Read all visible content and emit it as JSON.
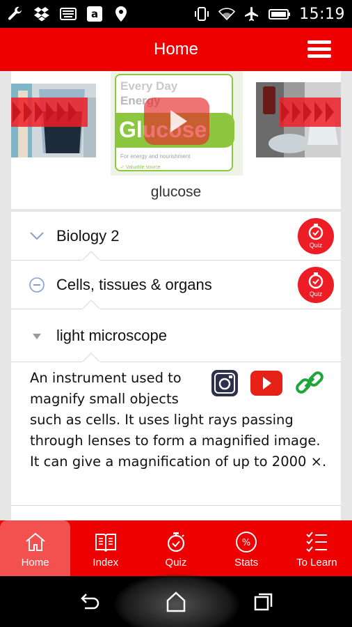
{
  "status_bar": {
    "time": "15:19",
    "left_icons": [
      "wrench-icon",
      "dropbox-icon",
      "keyboard-icon",
      "amazon-icon",
      "location-icon"
    ],
    "right_icons": [
      "vibrate-icon",
      "wifi-icon",
      "airplane-icon",
      "battery-icon"
    ]
  },
  "app_bar": {
    "title": "Home",
    "menu_icon": "hamburger-menu-icon"
  },
  "carousel": {
    "caption": "glucose",
    "center_image": {
      "line1": "Every Day",
      "line2": "Energy",
      "line3": "Glucose",
      "line4": "For energy and nourishment",
      "line5": "✓ Valuable source"
    }
  },
  "accordion": {
    "level1": {
      "label": "Biology 2",
      "quiz_label": "Quiz"
    },
    "level2": {
      "label": "Cells, tissues & organs",
      "quiz_label": "Quiz"
    },
    "term": {
      "label": "light microscope"
    },
    "definition": "An instrument used to magnify small objects such as cells. It uses light rays passing through lenses to form a magnified image. It can give a magnification of up to 2000 ×.",
    "media_icons": [
      "instagram-icon",
      "youtube-icon",
      "link-icon"
    ]
  },
  "bottom_nav": {
    "items": [
      {
        "label": "Home",
        "icon": "home-icon",
        "active": true
      },
      {
        "label": "Index",
        "icon": "book-icon",
        "active": false
      },
      {
        "label": "Quiz",
        "icon": "stopwatch-icon",
        "active": false
      },
      {
        "label": "Stats",
        "icon": "percent-icon",
        "active": false
      },
      {
        "label": "To Learn",
        "icon": "checklist-icon",
        "active": false
      }
    ]
  },
  "system_nav": [
    "back-icon",
    "home-icon",
    "recent-apps-icon"
  ],
  "colors": {
    "brand_red": "#ee0000",
    "active_tab": "#f35050",
    "quiz_red": "#ee1c25",
    "link_green": "#1fa53a",
    "youtube_red": "#e62117"
  }
}
